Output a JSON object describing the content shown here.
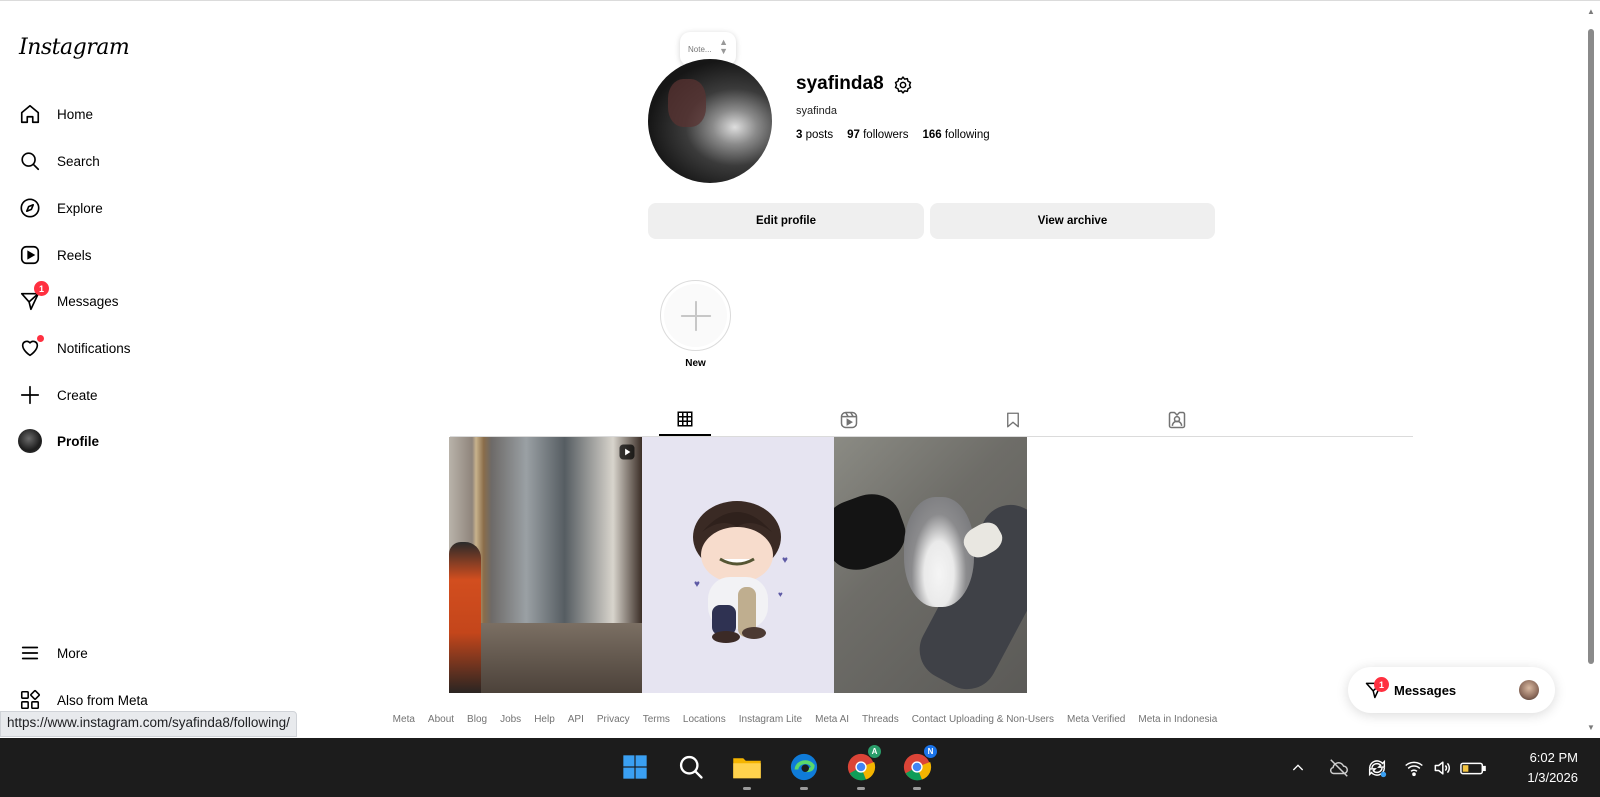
{
  "sidebar": {
    "logo": "Instagram",
    "items": [
      {
        "label": "Home",
        "icon": "home-icon"
      },
      {
        "label": "Search",
        "icon": "search-icon"
      },
      {
        "label": "Explore",
        "icon": "compass-icon"
      },
      {
        "label": "Reels",
        "icon": "reels-icon"
      },
      {
        "label": "Messages",
        "icon": "messenger-icon",
        "badge": "1"
      },
      {
        "label": "Notifications",
        "icon": "heart-icon"
      },
      {
        "label": "Create",
        "icon": "plus-icon"
      },
      {
        "label": "Profile",
        "icon": "avatar"
      },
      {
        "label": "More",
        "icon": "menu-icon"
      },
      {
        "label": "Also from Meta",
        "icon": "meta-apps-icon"
      }
    ]
  },
  "profile": {
    "note_placeholder": "Note...",
    "username": "syafinda8",
    "full_name": "syafinda",
    "posts_count": "3",
    "posts_label": "posts",
    "followers_count": "97",
    "followers_label": "followers",
    "following_count": "166",
    "following_label": "following",
    "edit_button": "Edit profile",
    "archive_button": "View archive",
    "highlight_new": "New"
  },
  "tabs": [
    {
      "icon": "grid-icon",
      "active": true
    },
    {
      "icon": "reels-icon",
      "active": false
    },
    {
      "icon": "bookmark-icon",
      "active": false
    },
    {
      "icon": "tagged-icon",
      "active": false
    }
  ],
  "posts": [
    {
      "type": "reel"
    },
    {
      "type": "image"
    },
    {
      "type": "image"
    }
  ],
  "footer": [
    "Meta",
    "About",
    "Blog",
    "Jobs",
    "Help",
    "API",
    "Privacy",
    "Terms",
    "Locations",
    "Instagram Lite",
    "Meta AI",
    "Threads",
    "Contact Uploading & Non-Users",
    "Meta Verified",
    "Meta in Indonesia"
  ],
  "messages_pill": {
    "label": "Messages",
    "badge": "1"
  },
  "status_url": "https://www.instagram.com/syafinda8/following/",
  "taskbar": {
    "time": "6:02 PM",
    "date": "1/3/2026",
    "apps": [
      "windows-start-icon",
      "search-icon",
      "file-explorer-icon",
      "edge-icon",
      "chrome-icon",
      "chrome-icon"
    ],
    "chrome_badges": [
      "A",
      "N"
    ]
  },
  "colors": {
    "badge": "#ff3040",
    "button_bg": "#efefef",
    "taskbar": "#1c1c1c",
    "link_gray": "#737373"
  }
}
